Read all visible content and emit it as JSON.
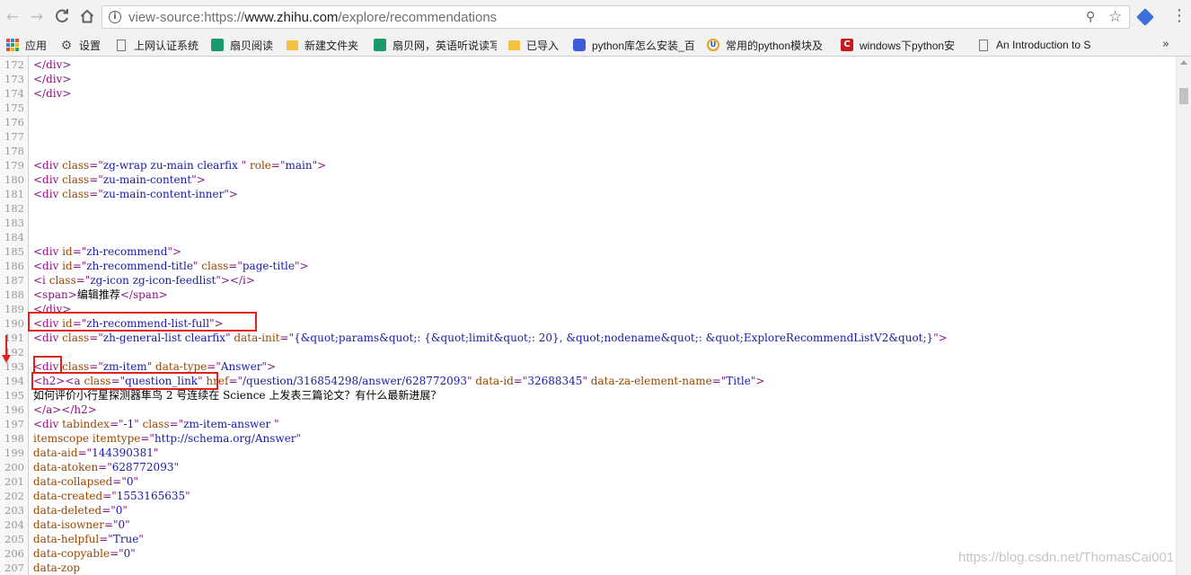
{
  "browser": {
    "url_scheme": "view-source:https://",
    "url_host": "www.zhihu.com",
    "url_path": "/explore/recommendations"
  },
  "bookmarks": [
    {
      "label": "应用",
      "icon": "apps-grid-icon"
    },
    {
      "label": "设置",
      "icon": "gear-icon"
    },
    {
      "label": "上网认证系统",
      "icon": "page-icon"
    },
    {
      "label": "扇贝阅读",
      "icon": "shanbay-icon"
    },
    {
      "label": "新建文件夹",
      "icon": "folder-icon"
    },
    {
      "label": "扇贝网，英语听说读写",
      "icon": "shanbay-icon"
    },
    {
      "label": "已导入",
      "icon": "folder-icon"
    },
    {
      "label": "python库怎么安装_百",
      "icon": "baidu-paw-icon"
    },
    {
      "label": "常用的python模块及",
      "icon": "uc-icon"
    },
    {
      "label": "windows下python安",
      "icon": "csdn-icon"
    },
    {
      "label": "An Introduction to S",
      "icon": "page-icon"
    }
  ],
  "source_lines": [
    {
      "n": "172",
      "t": [
        [
          "tag",
          "</div>"
        ]
      ]
    },
    {
      "n": "173",
      "t": [
        [
          "tag",
          "</div>"
        ]
      ]
    },
    {
      "n": "174",
      "t": [
        [
          "tag",
          "</div>"
        ]
      ]
    },
    {
      "n": "175",
      "t": []
    },
    {
      "n": "176",
      "t": []
    },
    {
      "n": "177",
      "t": []
    },
    {
      "n": "178",
      "t": []
    },
    {
      "n": "179",
      "t": [
        [
          "tag",
          "<div "
        ],
        [
          "attr",
          "class"
        ],
        [
          "tag",
          "=\""
        ],
        [
          "val",
          "zg-wrap zu-main clearfix "
        ],
        [
          "tag",
          "\" "
        ],
        [
          "attr",
          "role"
        ],
        [
          "tag",
          "=\""
        ],
        [
          "val",
          "main"
        ],
        [
          "tag",
          "\">"
        ]
      ]
    },
    {
      "n": "180",
      "t": [
        [
          "tag",
          "<div "
        ],
        [
          "attr",
          "class"
        ],
        [
          "tag",
          "=\""
        ],
        [
          "val",
          "zu-main-content"
        ],
        [
          "tag",
          "\">"
        ]
      ]
    },
    {
      "n": "181",
      "t": [
        [
          "tag",
          "<div "
        ],
        [
          "attr",
          "class"
        ],
        [
          "tag",
          "=\""
        ],
        [
          "val",
          "zu-main-content-inner"
        ],
        [
          "tag",
          "\">"
        ]
      ]
    },
    {
      "n": "182",
      "t": []
    },
    {
      "n": "183",
      "t": []
    },
    {
      "n": "184",
      "t": []
    },
    {
      "n": "185",
      "t": [
        [
          "tag",
          "<div "
        ],
        [
          "attr",
          "id"
        ],
        [
          "tag",
          "=\""
        ],
        [
          "val",
          "zh-recommend"
        ],
        [
          "tag",
          "\">"
        ]
      ]
    },
    {
      "n": "186",
      "t": [
        [
          "tag",
          "<div "
        ],
        [
          "attr",
          "id"
        ],
        [
          "tag",
          "=\""
        ],
        [
          "val",
          "zh-recommend-title"
        ],
        [
          "tag",
          "\" "
        ],
        [
          "attr",
          "class"
        ],
        [
          "tag",
          "=\""
        ],
        [
          "val",
          "page-title"
        ],
        [
          "tag",
          "\">"
        ]
      ]
    },
    {
      "n": "187",
      "t": [
        [
          "tag",
          "<i "
        ],
        [
          "attr",
          "class"
        ],
        [
          "tag",
          "=\""
        ],
        [
          "val",
          "zg-icon zg-icon-feedlist"
        ],
        [
          "tag",
          "\"></i>"
        ]
      ]
    },
    {
      "n": "188",
      "t": [
        [
          "tag",
          "<span>"
        ],
        [
          "txt",
          "编辑推荐"
        ],
        [
          "tag",
          "</span>"
        ]
      ]
    },
    {
      "n": "189",
      "t": [
        [
          "tag",
          "</div>"
        ]
      ]
    },
    {
      "n": "190",
      "t": [
        [
          "tag",
          "<div "
        ],
        [
          "attr",
          "id"
        ],
        [
          "tag",
          "=\""
        ],
        [
          "val",
          "zh-recommend-list-full"
        ],
        [
          "tag",
          "\">"
        ]
      ]
    },
    {
      "n": "191",
      "t": [
        [
          "tag",
          "<div "
        ],
        [
          "attr",
          "class"
        ],
        [
          "tag",
          "=\""
        ],
        [
          "val",
          "zh-general-list clearfix"
        ],
        [
          "tag",
          "\" "
        ],
        [
          "attr",
          "data-init"
        ],
        [
          "tag",
          "=\""
        ],
        [
          "val",
          "{&quot;params&quot;: {&quot;limit&quot;: 20}, &quot;nodename&quot;: &quot;ExploreRecommendListV2&quot;}"
        ],
        [
          "tag",
          "\">"
        ]
      ]
    },
    {
      "n": "192",
      "t": []
    },
    {
      "n": "193",
      "t": [
        [
          "tag",
          "<div "
        ],
        [
          "attr",
          "class"
        ],
        [
          "tag",
          "=\""
        ],
        [
          "val",
          "zm-item"
        ],
        [
          "tag",
          "\" "
        ],
        [
          "attr",
          "data-type"
        ],
        [
          "tag",
          "=\""
        ],
        [
          "val",
          "Answer"
        ],
        [
          "tag",
          "\">"
        ]
      ]
    },
    {
      "n": "194",
      "t": [
        [
          "tag",
          "<h2><a "
        ],
        [
          "attr",
          "class"
        ],
        [
          "tag",
          "=\""
        ],
        [
          "val",
          "question_link"
        ],
        [
          "tag",
          "\" "
        ],
        [
          "attr",
          "href"
        ],
        [
          "tag",
          "=\""
        ],
        [
          "val",
          "/question/316854298/answer/628772093"
        ],
        [
          "tag",
          "\" "
        ],
        [
          "attr",
          "data-id"
        ],
        [
          "tag",
          "=\""
        ],
        [
          "val",
          "32688345"
        ],
        [
          "tag",
          "\" "
        ],
        [
          "attr",
          "data-za-element-name"
        ],
        [
          "tag",
          "=\""
        ],
        [
          "val",
          "Title"
        ],
        [
          "tag",
          "\">"
        ]
      ]
    },
    {
      "n": "195",
      "t": [
        [
          "txt",
          "如何评价小行星探测器隼鸟 2 号连续在 Science 上发表三篇论文？有什么最新进展？"
        ]
      ]
    },
    {
      "n": "196",
      "t": [
        [
          "tag",
          "</a></h2>"
        ]
      ]
    },
    {
      "n": "197",
      "t": [
        [
          "tag",
          "<div "
        ],
        [
          "attr",
          "tabindex"
        ],
        [
          "tag",
          "=\""
        ],
        [
          "val",
          "-1"
        ],
        [
          "tag",
          "\" "
        ],
        [
          "attr",
          "class"
        ],
        [
          "tag",
          "=\""
        ],
        [
          "val",
          "zm-item-answer "
        ],
        [
          "tag",
          "\""
        ]
      ]
    },
    {
      "n": "198",
      "t": [
        [
          "attr",
          "itemscope itemtype"
        ],
        [
          "tag",
          "=\""
        ],
        [
          "val",
          "http://schema.org/Answer"
        ],
        [
          "tag",
          "\""
        ]
      ]
    },
    {
      "n": "199",
      "t": [
        [
          "attr",
          "data-aid"
        ],
        [
          "tag",
          "=\""
        ],
        [
          "val",
          "144390381"
        ],
        [
          "tag",
          "\""
        ]
      ]
    },
    {
      "n": "200",
      "t": [
        [
          "attr",
          "data-atoken"
        ],
        [
          "tag",
          "=\""
        ],
        [
          "val",
          "628772093"
        ],
        [
          "tag",
          "\""
        ]
      ]
    },
    {
      "n": "201",
      "t": [
        [
          "attr",
          "data-collapsed"
        ],
        [
          "tag",
          "=\""
        ],
        [
          "val",
          "0"
        ],
        [
          "tag",
          "\""
        ]
      ]
    },
    {
      "n": "202",
      "t": [
        [
          "attr",
          "data-created"
        ],
        [
          "tag",
          "=\""
        ],
        [
          "val",
          "1553165635"
        ],
        [
          "tag",
          "\""
        ]
      ]
    },
    {
      "n": "203",
      "t": [
        [
          "attr",
          "data-deleted"
        ],
        [
          "tag",
          "=\""
        ],
        [
          "val",
          "0"
        ],
        [
          "tag",
          "\""
        ]
      ]
    },
    {
      "n": "204",
      "t": [
        [
          "attr",
          "data-isowner"
        ],
        [
          "tag",
          "=\""
        ],
        [
          "val",
          "0"
        ],
        [
          "tag",
          "\""
        ]
      ]
    },
    {
      "n": "205",
      "t": [
        [
          "attr",
          "data-helpful"
        ],
        [
          "tag",
          "=\""
        ],
        [
          "val",
          "True"
        ],
        [
          "tag",
          "\""
        ]
      ]
    },
    {
      "n": "206",
      "t": [
        [
          "attr",
          "data-copyable"
        ],
        [
          "tag",
          "=\""
        ],
        [
          "val",
          "0"
        ],
        [
          "tag",
          "\""
        ]
      ]
    },
    {
      "n": "207",
      "t": [
        [
          "attr",
          "data-zop"
        ]
      ]
    }
  ],
  "watermark": "https://blog.csdn.net/ThomasCai001",
  "colors": {
    "tag": "#881280",
    "attr": "#994500",
    "value": "#1a1aa6",
    "annotation": "#e0201a"
  }
}
